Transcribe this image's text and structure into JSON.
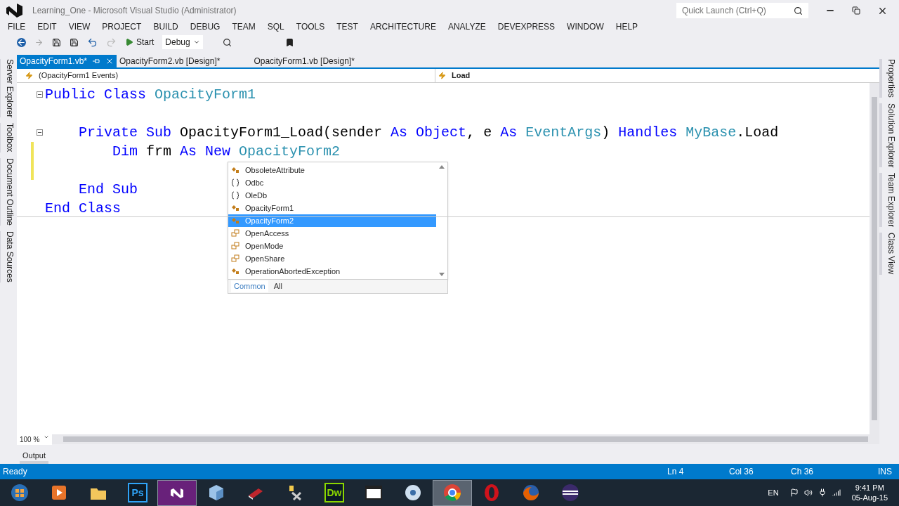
{
  "window": {
    "title": "Learning_One - Microsoft Visual Studio (Administrator)",
    "quick_launch": {
      "placeholder": "Quick Launch (Ctrl+Q)"
    }
  },
  "menu": [
    "FILE",
    "EDIT",
    "VIEW",
    "PROJECT",
    "BUILD",
    "DEBUG",
    "TEAM",
    "SQL",
    "TOOLS",
    "TEST",
    "ARCHITECTURE",
    "ANALYZE",
    "DEVEXPRESS",
    "WINDOW",
    "HELP"
  ],
  "toolbar": {
    "start": "Start",
    "configuration": "Debug"
  },
  "left_panels": [
    "Server Explorer",
    "Toolbox",
    "Document Outline",
    "Data Sources"
  ],
  "right_panels": [
    "Properties",
    "Solution Explorer",
    "Team Explorer",
    "Class View"
  ],
  "tabs": [
    {
      "label": "OpacityForm1.vb*",
      "selected": true
    },
    {
      "label": "OpacityForm2.vb [Design]*",
      "selected": false
    },
    {
      "label": "OpacityForm1.vb [Design]*",
      "selected": false
    }
  ],
  "nav": {
    "left": "(OpacityForm1 Events)",
    "right": "Load"
  },
  "code": [
    {
      "collapsible": true,
      "changed": false,
      "tokens": [
        {
          "kind": "keyword",
          "text": "Public Class "
        },
        {
          "kind": "type",
          "text": "OpacityForm1"
        }
      ]
    },
    {
      "collapsible": false,
      "changed": false
    },
    {
      "collapsible": true,
      "changed": false,
      "tokens": [
        {
          "kind": "keyword",
          "text": "    Private Sub "
        },
        {
          "kind": "plain",
          "text": "OpacityForm1_Load(sender "
        },
        {
          "kind": "keyword",
          "text": "As Object"
        },
        {
          "kind": "plain",
          "text": ", e "
        },
        {
          "kind": "keyword",
          "text": "As "
        },
        {
          "kind": "type",
          "text": "EventArgs"
        },
        {
          "kind": "plain",
          "text": ") "
        },
        {
          "kind": "keyword",
          "text": "Handles "
        },
        {
          "kind": "type",
          "text": "MyBase"
        },
        {
          "kind": "plain",
          "text": ".Load"
        }
      ]
    },
    {
      "collapsible": false,
      "changed": true,
      "tokens": [
        {
          "kind": "keyword",
          "text": "        Dim "
        },
        {
          "kind": "plain",
          "text": "frm "
        },
        {
          "kind": "keyword",
          "text": "As New "
        },
        {
          "kind": "type",
          "text": "OpacityForm2"
        }
      ]
    },
    {
      "collapsible": false,
      "changed": true
    },
    {
      "collapsible": false,
      "changed": false,
      "tokens": [
        {
          "kind": "keyword",
          "text": "    End Sub"
        }
      ]
    },
    {
      "collapsible": false,
      "changed": false,
      "tokens": [
        {
          "kind": "keyword",
          "text": "End Class"
        }
      ]
    }
  ],
  "completion": {
    "items": [
      {
        "kind": "class",
        "label": "ObsoleteAttribute",
        "selected": false
      },
      {
        "kind": "namespace",
        "label": "Odbc",
        "selected": false
      },
      {
        "kind": "namespace",
        "label": "OleDb",
        "selected": false
      },
      {
        "kind": "class",
        "label": "OpacityForm1",
        "selected": false
      },
      {
        "kind": "class",
        "label": "OpacityForm2",
        "selected": true
      },
      {
        "kind": "enum",
        "label": "OpenAccess",
        "selected": false
      },
      {
        "kind": "enum",
        "label": "OpenMode",
        "selected": false
      },
      {
        "kind": "enum",
        "label": "OpenShare",
        "selected": false
      },
      {
        "kind": "class",
        "label": "OperationAbortedException",
        "selected": false
      }
    ],
    "filters": [
      {
        "label": "Common",
        "selected": true
      },
      {
        "label": "All",
        "selected": false
      }
    ]
  },
  "zoom": "100 %",
  "output_tab": "Output",
  "status": {
    "text": "Ready",
    "ln": "Ln 4",
    "col": "Col 36",
    "ch": "Ch 36",
    "mode": "INS"
  },
  "taskbar": {
    "apps": [
      {
        "kind": "start",
        "active": false
      },
      {
        "kind": "media",
        "active": false
      },
      {
        "kind": "folder",
        "active": false
      },
      {
        "kind": "text",
        "label": "Ps",
        "color": "#2fa3f7",
        "active": false
      },
      {
        "kind": "vs",
        "active": true
      },
      {
        "kind": "cube",
        "active": false
      },
      {
        "kind": "book",
        "active": false
      },
      {
        "kind": "tools",
        "active": false
      },
      {
        "kind": "text",
        "label": "Dw",
        "color": "#8bd700",
        "active": false
      },
      {
        "kind": "window",
        "active": false
      },
      {
        "kind": "disc",
        "active": false
      },
      {
        "kind": "chrome",
        "active": true
      },
      {
        "kind": "opera",
        "active": false
      },
      {
        "kind": "firefox",
        "active": false
      },
      {
        "kind": "eclipse",
        "active": false
      }
    ],
    "language": "EN",
    "time": "9:41 PM",
    "date": "05-Aug-15"
  }
}
